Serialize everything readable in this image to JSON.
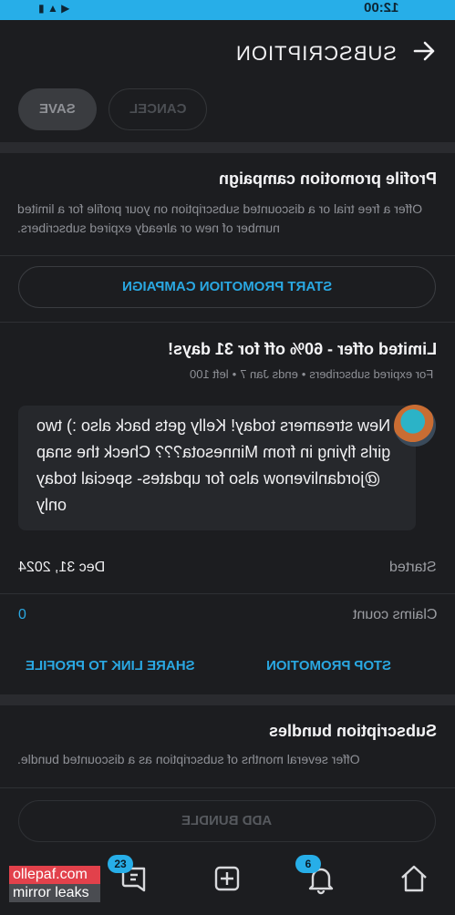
{
  "status": {
    "time": "12:00",
    "signal": "◀ ▲ ▮"
  },
  "header": {
    "title": "SUBSCRIPTION"
  },
  "actions": {
    "save": "SAVE",
    "cancel": "CANCEL"
  },
  "promo": {
    "title": "Profile promotion campaign",
    "description": "Offer a free trial or a discounted subscription on your profile for a limited number of new or already expired subscribers.",
    "start_button": "START PROMOTION CAMPAIGN"
  },
  "offer": {
    "title": "Limited offer - 60% off for 31 days!",
    "meta": [
      "For expired subscribers",
      "ends Jan 7",
      "left 100"
    ],
    "message": "New streamers today! Kelly gets back also :) two girls flying in from Minnesota??? Check the snap @jordanlivenow also for updates- special today only",
    "started_label": "Started",
    "started_value": "Dec 31, 2024",
    "claims_label": "Claims count",
    "claims_value": "0",
    "stop_button": "STOP PROMOTION",
    "share_button": "SHARE LINK TO PROFILE"
  },
  "bundles": {
    "title": "Subscription bundles",
    "description": "Offer several months of subscription as a discounted bundle.",
    "add_button": "ADD BUNDLE"
  },
  "tabbar": {
    "home_icon": "home-icon",
    "bell_badge": "6",
    "add_icon": "plus-square-icon",
    "messages_badge": "23"
  },
  "watermark": {
    "line1": "ollepaf.com",
    "line2": "mirror leaks"
  },
  "colors": {
    "accent": "#27aee8",
    "background": "#1c1d20"
  }
}
